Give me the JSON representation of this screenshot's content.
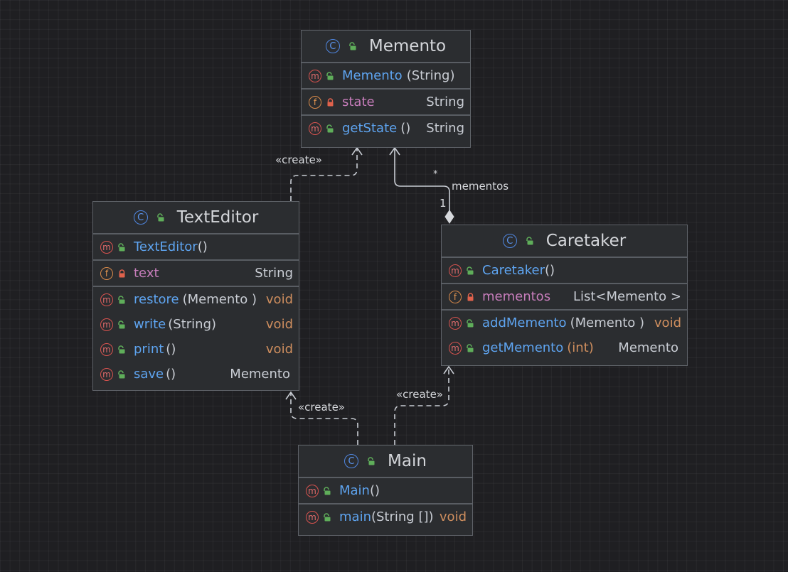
{
  "classes": {
    "memento": {
      "title": "Memento",
      "constructor": {
        "name": "Memento",
        "params": "(String)"
      },
      "field": {
        "name": "state",
        "type": "String"
      },
      "method": {
        "name": "getState",
        "params": "()",
        "type": "String"
      }
    },
    "texteditor": {
      "title": "TextEditor",
      "constructor": {
        "name": "TextEditor",
        "params": "()"
      },
      "field": {
        "name": "text",
        "type": "String"
      },
      "methods": [
        {
          "name": "restore",
          "params": "(Memento )",
          "type": "void"
        },
        {
          "name": "write",
          "params": "(String)",
          "type": "void"
        },
        {
          "name": "print",
          "params": "()",
          "type": "void"
        },
        {
          "name": "save",
          "params": "()",
          "type": "Memento"
        }
      ]
    },
    "caretaker": {
      "title": "Caretaker",
      "constructor": {
        "name": "Caretaker",
        "params": "()"
      },
      "field": {
        "name": "mementos",
        "type": "List<Memento >"
      },
      "methods": [
        {
          "name": "addMemento",
          "params": "(Memento )",
          "type": "void"
        },
        {
          "name": "getMemento",
          "params": "(int)",
          "type": "Memento"
        }
      ]
    },
    "main": {
      "title": "Main",
      "constructor": {
        "name": "Main",
        "params": "()"
      },
      "method": {
        "name": "main",
        "params": "(String [])",
        "type": "void"
      }
    }
  },
  "relations": {
    "create_label": "«create»",
    "association_role": "mementos",
    "mult_many": "*",
    "mult_one": "1"
  },
  "badges": {
    "method": "m",
    "field": "f",
    "class": "C"
  },
  "colors": {
    "background": "#1f1f22",
    "box": "#2b2d30",
    "method_name": "#5ea4f0",
    "field_name": "#c77dbb",
    "void_type": "#cf8e5e",
    "method_badge": "#d9534f",
    "field_badge": "#d98a4a",
    "class_badge": "#4f86e0",
    "public_lock": "#5fae5a",
    "private_lock": "#e0624c"
  }
}
